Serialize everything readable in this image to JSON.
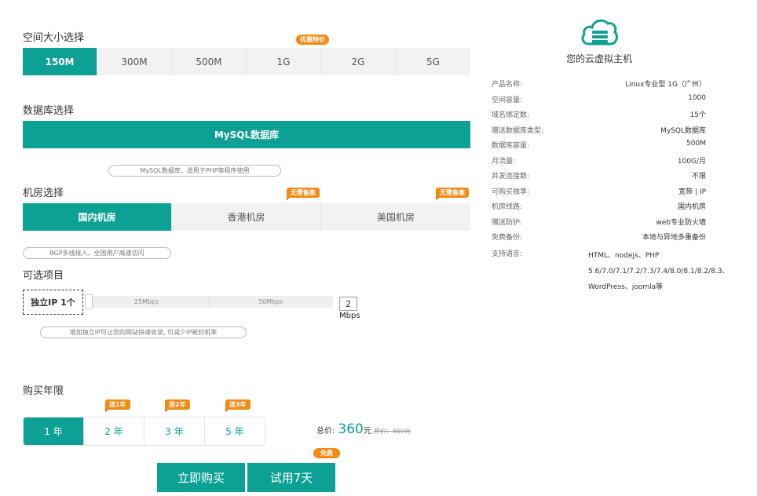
{
  "space": {
    "title": "空间大小选择",
    "promo_tag": "优惠特价",
    "options": [
      "150M",
      "300M",
      "500M",
      "1G",
      "2G",
      "5G"
    ],
    "selected": 0
  },
  "database": {
    "title": "数据库选择",
    "option": "MySQL数据库",
    "hint": "MySQL数据库，适用于PHP等程序使用"
  },
  "datacenter": {
    "title": "机房选择",
    "options": [
      "国内机房",
      "香港机房",
      "美国机房"
    ],
    "tag_hk": "无需备案",
    "tag_us": "无需备案",
    "hint": "BGP多线接入，全国用户高速访问"
  },
  "optional": {
    "title": "可选项目",
    "item_label": "独立IP 1个",
    "slider_marks": [
      "25Mbps",
      "50Mbps"
    ],
    "quantity": "2",
    "unit": "Mbps",
    "hint": "增加独立IP可让您的网站快速收录, 可减少IP被封机率"
  },
  "period": {
    "title": "购买年限",
    "options": [
      "1 年",
      "2 年",
      "3 年",
      "5 年"
    ],
    "gifts": [
      "送1年",
      "送2年",
      "送3年"
    ],
    "selected": 0
  },
  "price": {
    "label": "总价:",
    "amount": "360",
    "currency": "元",
    "original": "原价：860元"
  },
  "actions": {
    "buy_label": "立即购买",
    "trial_label": "试用7天",
    "free_tag": "免费"
  },
  "summary": {
    "heading": "您的云虚拟主机",
    "specs": [
      {
        "k": "产品名称:",
        "v": "Linux专业型 1G（广州）"
      },
      {
        "k": "空间容量:",
        "v": "1000"
      },
      {
        "k": "域名绑定数:",
        "v": "15个"
      },
      {
        "k": "赠送数据库类型:",
        "v": "MySQL数据库"
      },
      {
        "k": "数据库容量:",
        "v": "500M"
      },
      {
        "k": "月流量:",
        "v": "100G/月"
      },
      {
        "k": "并发连接数:",
        "v": "不限"
      },
      {
        "k": "可购买独享:",
        "v": "宽带 | IP"
      },
      {
        "k": "机房线路:",
        "v": "国内机房"
      },
      {
        "k": "赠送防护:",
        "v": "web专业防火墙"
      },
      {
        "k": "免费备份:",
        "v": "本地与异地多重备份"
      }
    ],
    "lang_key": "支持语言:",
    "lang_lines": [
      "HTML、nodejs、PHP",
      "5.6/7.0/7.1/7.2/7.3/7.4/8.0/8.1/8.2/8.3、",
      "WordPress、joomla等"
    ]
  },
  "colors": {
    "primary": "#0da195",
    "tag": "#f28a13"
  }
}
